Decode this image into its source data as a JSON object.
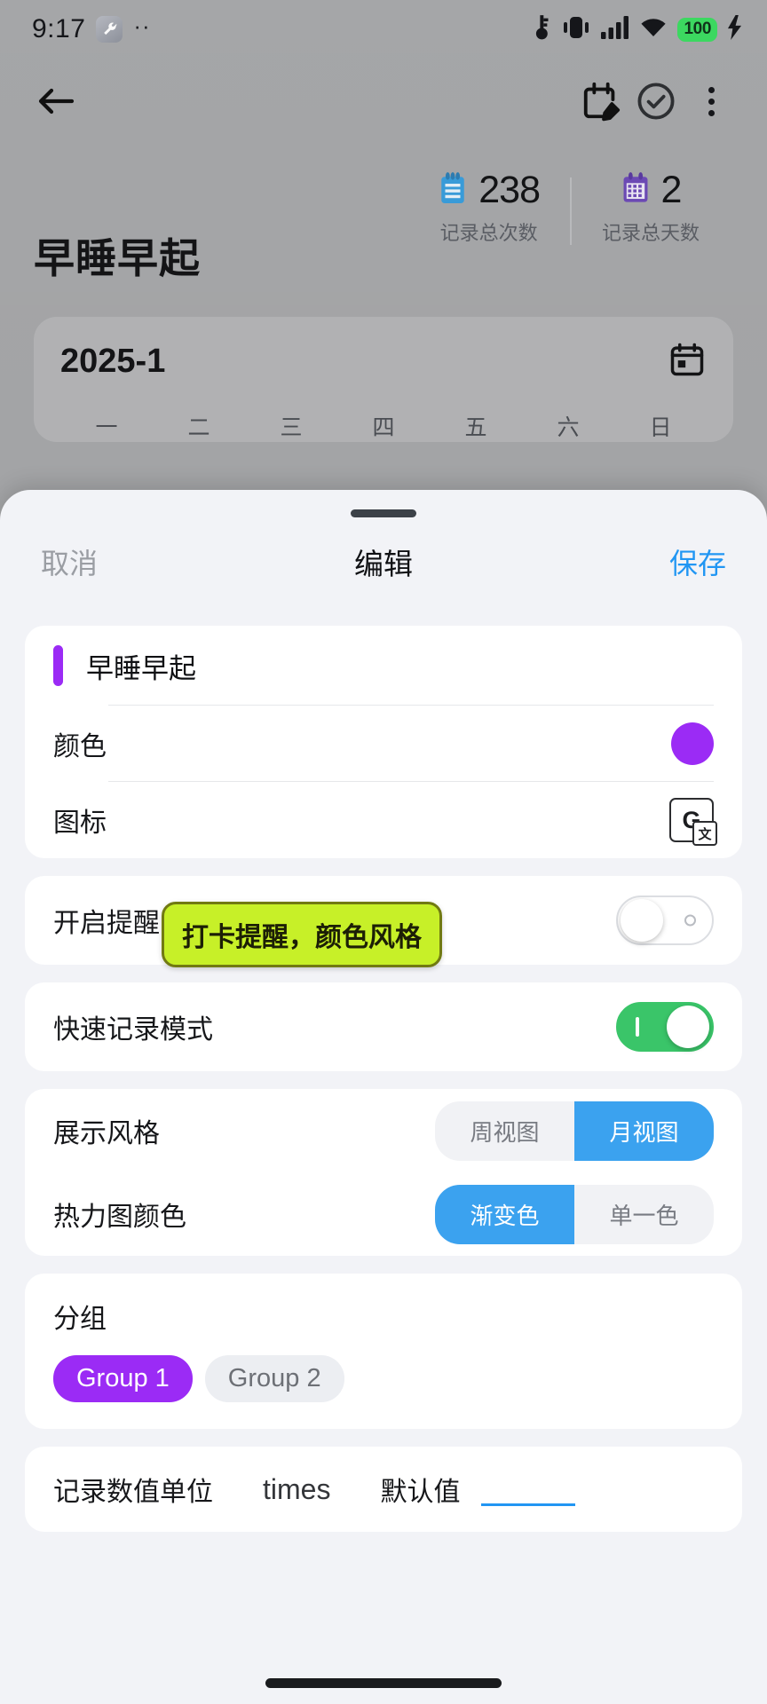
{
  "status_bar": {
    "time": "9:17",
    "wrench_icon": "wrench-icon",
    "more_dots": "··",
    "icons": [
      "key-icon",
      "vibrate-icon",
      "signal-icon",
      "wifi-icon"
    ],
    "battery_level": "100",
    "battery_color": "#3ddc62",
    "charging_icon": "charging-bolt-icon"
  },
  "app": {
    "toolbar": {
      "back_icon": "back-arrow-icon",
      "calendar_edit_icon": "calendar-edit-icon",
      "check_circle_icon": "check-circle-icon",
      "overflow_icon": "kebab-menu-icon"
    },
    "habit_title": "早睡早起",
    "stats": [
      {
        "icon": "notepad-icon",
        "value": "238",
        "label": "记录总次数"
      },
      {
        "icon": "calendar-icon",
        "value": "2",
        "label": "记录总天数"
      }
    ],
    "calendar": {
      "month": "2025-1",
      "calendar_icon": "calendar-outline-icon",
      "weekdays": [
        "一",
        "二",
        "三",
        "四",
        "五",
        "六",
        "日"
      ]
    }
  },
  "sheet": {
    "cancel": "取消",
    "title": "编辑",
    "save": "保存",
    "save_color": "#2196f3",
    "name_field": {
      "value": "早睡早起",
      "placeholder": "早睡早起",
      "accent_color": "#9b2bf5"
    },
    "color_row": {
      "label": "颜色",
      "value_color": "#9b2bf5"
    },
    "icon_row": {
      "label": "图标",
      "icon_glyph": "G",
      "icon_sub_glyph": "文",
      "icon_name": "google-translate-icon"
    },
    "reminder_row": {
      "label": "开启提醒",
      "enabled": false
    },
    "quick_record_row": {
      "label": "快速记录模式",
      "enabled": true,
      "on_color": "#3ac569"
    },
    "display_style_row": {
      "label": "展示风格",
      "options": [
        "周视图",
        "月视图"
      ],
      "selected_index": 1
    },
    "heatmap_color_row": {
      "label": "热力图颜色",
      "options": [
        "渐变色",
        "单一色"
      ],
      "selected_index": 0
    },
    "group_section": {
      "label": "分组",
      "chips": [
        "Group 1",
        "Group 2"
      ],
      "selected_index": 0,
      "selected_color": "#9b2bf5"
    },
    "unit_row": {
      "label": "记录数值单位",
      "unit_value": "times",
      "default_label": "默认值",
      "default_value": "",
      "default_placeholder": ""
    },
    "tooltip": "打卡提醒，颜色风格",
    "tooltip_bg": "#c7f028"
  }
}
